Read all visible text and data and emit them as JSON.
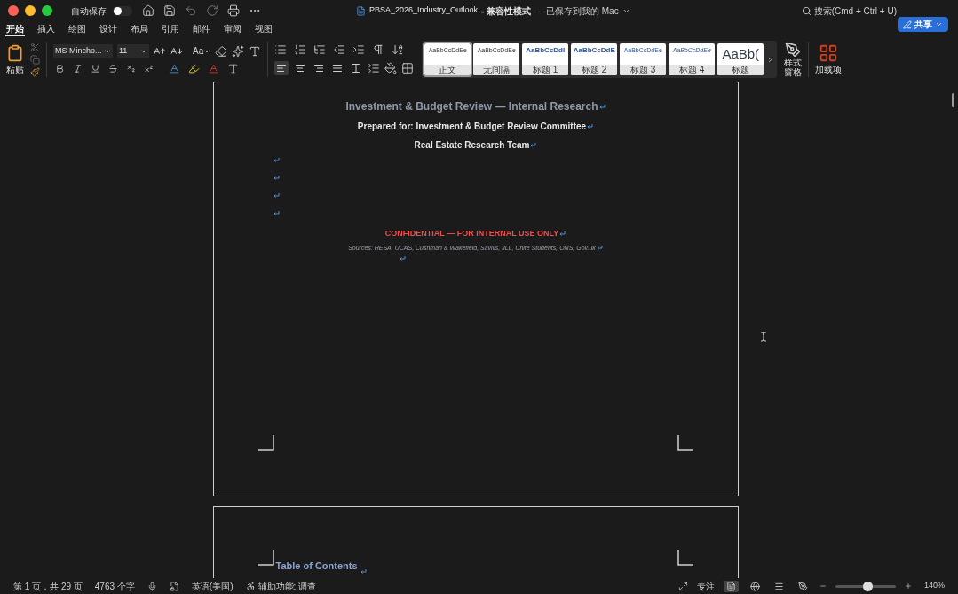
{
  "window": {
    "title": "PBSA_2026_Industry_Outlook",
    "mode": "- 兼容性模式",
    "save_status": "— 已保存到我的 Mac"
  },
  "autosave": {
    "label": "自动保存",
    "on": false
  },
  "search": {
    "placeholder": "搜索(Cmd + Ctrl + U)"
  },
  "share": {
    "label": "共享"
  },
  "tabs": [
    {
      "label": "开始",
      "selected": true
    },
    {
      "label": "插入",
      "selected": false
    },
    {
      "label": "绘图",
      "selected": false
    },
    {
      "label": "设计",
      "selected": false
    },
    {
      "label": "布局",
      "selected": false
    },
    {
      "label": "引用",
      "selected": false
    },
    {
      "label": "邮件",
      "selected": false
    },
    {
      "label": "审阅",
      "selected": false
    },
    {
      "label": "视图",
      "selected": false
    }
  ],
  "ribbon": {
    "paste": "粘贴",
    "font": "MS Mincho...",
    "size": "11",
    "case": "Aa",
    "alignment": [
      {
        "kind": "left",
        "selected": true
      },
      {
        "kind": "center",
        "selected": false
      },
      {
        "kind": "right",
        "selected": false
      },
      {
        "kind": "justify",
        "selected": false
      },
      {
        "kind": "distributed",
        "selected": false
      }
    ],
    "styles": [
      {
        "preview": "AaBbCcDdEe",
        "name": "正文",
        "kind": "body",
        "selected": true
      },
      {
        "preview": "AaBbCcDdEe",
        "name": "无间隔",
        "kind": "body",
        "selected": false
      },
      {
        "preview": "AaBbCcDdI",
        "name": "标题 1",
        "kind": "heading1",
        "selected": false
      },
      {
        "preview": "AaBbCcDdE",
        "name": "标题 2",
        "kind": "heading2",
        "selected": false
      },
      {
        "preview": "AaBbCcDdEe",
        "name": "标题 3",
        "kind": "heading3",
        "selected": false
      },
      {
        "preview": "AaBbCcDdEe",
        "name": "标题 4",
        "kind": "heading4",
        "selected": false
      },
      {
        "preview": "AaBb(",
        "name": "标题",
        "kind": "title",
        "selected": false
      }
    ],
    "style_pane": "样式窗格",
    "addins": "加载项"
  },
  "document": {
    "paragraphs": [
      {
        "kind": "title",
        "text": "Investment & Budget Review — Internal Research"
      },
      {
        "kind": "subtitle",
        "text": "Prepared for: Investment & Budget Review Committee"
      },
      {
        "kind": "subtitle",
        "text": "Real Estate Research Team"
      },
      {
        "kind": "empty"
      },
      {
        "kind": "empty"
      },
      {
        "kind": "empty"
      },
      {
        "kind": "empty"
      },
      {
        "kind": "confidential",
        "text": "CONFIDENTIAL — FOR INTERNAL USE ONLY"
      },
      {
        "kind": "sources",
        "text": "Sources: HESA, UCAS, Cushman & Wakefield, Savills, JLL, Unite Students, ONS, Gov.uk"
      },
      {
        "kind": "indented_empty"
      }
    ],
    "next_heading": "Table of Contents"
  },
  "status_bar": {
    "page": "第 1 页，共 29 页",
    "words": "4763 个字",
    "language": "英语(美国)",
    "accessibility": "辅助功能: 调查",
    "focus": "专注",
    "views": [
      {
        "kind": "print",
        "selected": true
      },
      {
        "kind": "web",
        "selected": false
      },
      {
        "kind": "outline",
        "selected": false
      },
      {
        "kind": "draft",
        "selected": false
      }
    ],
    "zoom": {
      "level": 0.53,
      "reading": "140%"
    }
  }
}
